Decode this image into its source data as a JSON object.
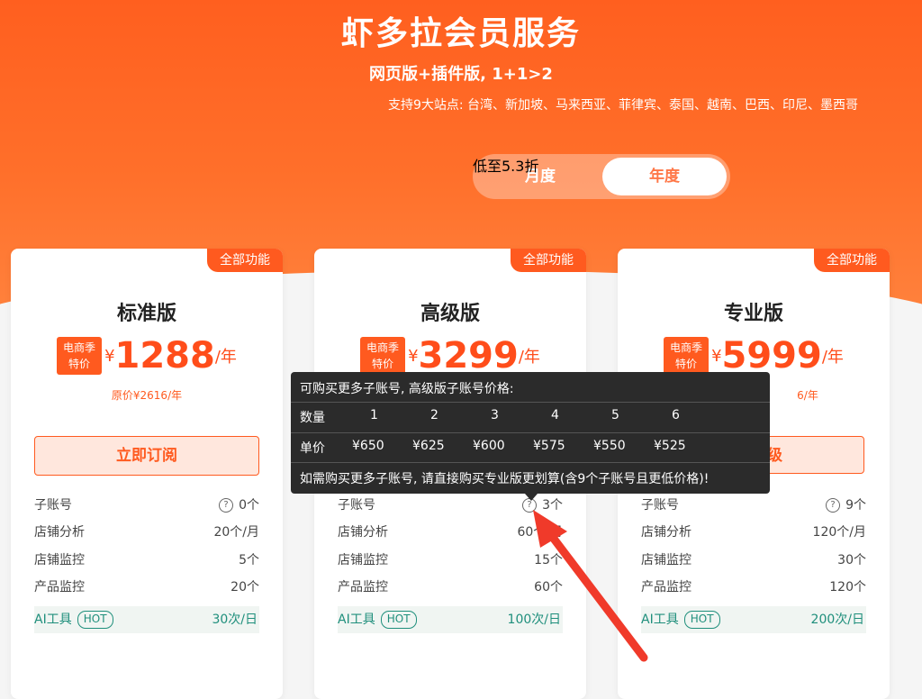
{
  "hero": {
    "title": "虾多拉会员服务",
    "subtitle": "网页版+插件版, 1+1>2",
    "sites": "支持9大站点: 台湾、新加坡、马来西亚、菲律宾、泰国、越南、巴西、印尼、墨西哥"
  },
  "billing_toggle": {
    "month_label": "月度",
    "year_label": "年度",
    "selected": "年度",
    "discount_badge": "低至5.3折"
  },
  "plans": [
    {
      "ribbon": "全部功能",
      "name": "标准版",
      "badge_line1": "电商季",
      "badge_line2": "特价",
      "currency": "¥",
      "price": "1288",
      "per": "/年",
      "original": "原价¥2616/年",
      "cta": "立即订阅",
      "features": [
        {
          "label": "子账号",
          "value": "0个"
        },
        {
          "label": "店铺分析",
          "value": "20个/月"
        },
        {
          "label": "店铺监控",
          "value": "5个"
        },
        {
          "label": "产品监控",
          "value": "20个"
        }
      ],
      "ai": {
        "label": "AI工具",
        "tag": "HOT",
        "value": "30次/日"
      }
    },
    {
      "ribbon": "全部功能",
      "name": "高级版",
      "badge_line1": "电商季",
      "badge_line2": "特价",
      "currency": "¥",
      "price": "3299",
      "per": "/年",
      "original": "",
      "cta": "",
      "features": [
        {
          "label": "子账号",
          "value": "3个"
        },
        {
          "label": "店铺分析",
          "value": "60个/月"
        },
        {
          "label": "店铺监控",
          "value": "15个"
        },
        {
          "label": "产品监控",
          "value": "60个"
        }
      ],
      "ai": {
        "label": "AI工具",
        "tag": "HOT",
        "value": "100次/日"
      }
    },
    {
      "ribbon": "全部功能",
      "name": "专业版",
      "badge_line1": "电商季",
      "badge_line2": "特价",
      "currency": "¥",
      "price": "5999",
      "per": "/年",
      "original": "6/年",
      "cta": "级",
      "features": [
        {
          "label": "子账号",
          "value": "9个"
        },
        {
          "label": "店铺分析",
          "value": "120个/月"
        },
        {
          "label": "店铺监控",
          "value": "30个"
        },
        {
          "label": "产品监控",
          "value": "120个"
        }
      ],
      "ai": {
        "label": "AI工具",
        "tag": "HOT",
        "value": "200次/日"
      }
    }
  ],
  "tooltip": {
    "heading": "可购买更多子账号, 高级版子账号价格:",
    "qty_label": "数量",
    "quantities": [
      "1",
      "2",
      "3",
      "4",
      "5",
      "6"
    ],
    "price_label": "单价",
    "prices": [
      "¥650",
      "¥625",
      "¥600",
      "¥575",
      "¥550",
      "¥525"
    ],
    "footer": "如需购买更多子账号, 请直接购买专业版更划算(含9个子账号且更低价格)!"
  },
  "colors": {
    "brand": "#ff5a1f",
    "ai_green": "#1f8f7c",
    "tooltip_bg": "#2b2b2b",
    "annotation_red": "#f03a2a"
  }
}
